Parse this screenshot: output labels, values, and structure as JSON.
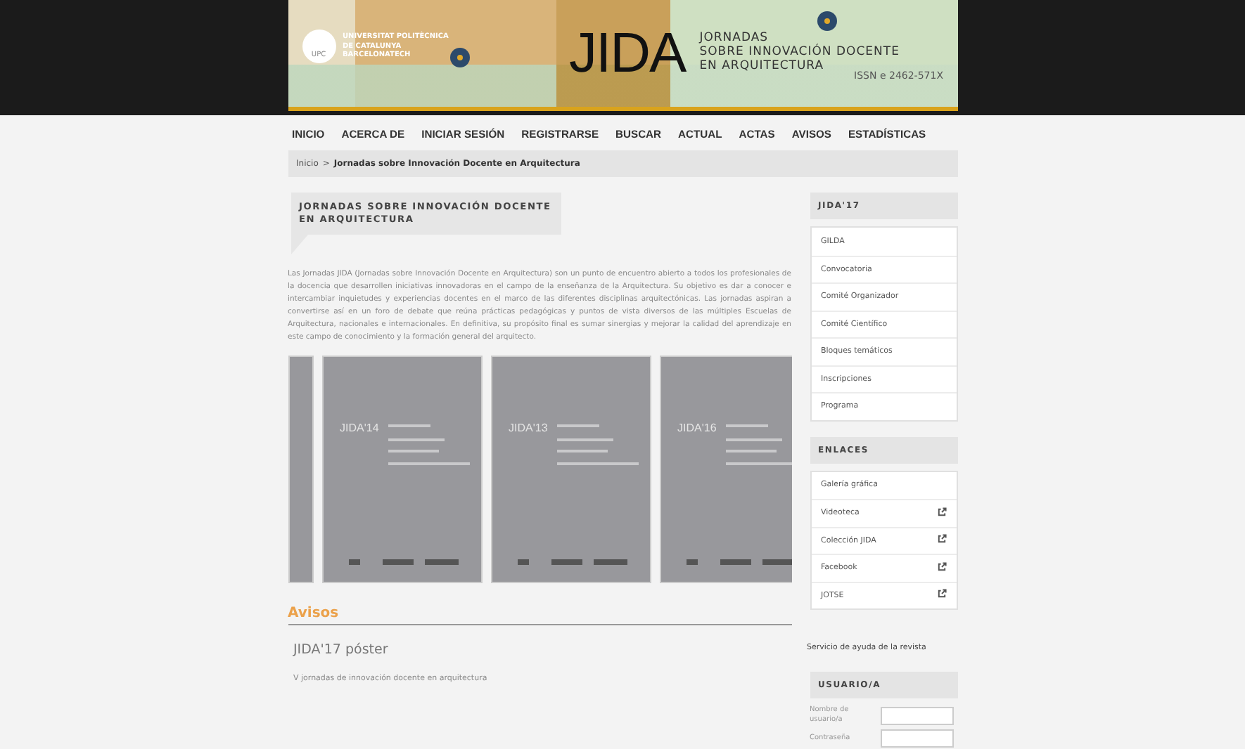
{
  "header": {
    "university": [
      "UNIVERSITAT POLITÈCNICA",
      "DE CATALUNYA",
      "BARCELONATECH"
    ],
    "logo_text": "UPC",
    "brand": "JIDA",
    "subtitle": [
      "JORNADAS",
      "SOBRE INNOVACIÓN DOCENTE",
      "EN ARQUITECTURA"
    ],
    "issn": "ISSN e 2462-571X"
  },
  "nav": [
    "INICIO",
    "ACERCA DE",
    "INICIAR SESIÓN",
    "REGISTRARSE",
    "BUSCAR",
    "ACTUAL",
    "ACTAS",
    "AVISOS",
    "ESTADÍSTICAS"
  ],
  "breadcrumb": {
    "home": "Inicio",
    "separator": ">",
    "current": "Jornadas sobre Innovación Docente en Arquitectura"
  },
  "main": {
    "title": "JORNADAS SOBRE INNOVACIÓN DOCENTE EN ARQUITECTURA",
    "intro": "Las Jornadas JIDA (Jornadas sobre Innovación Docente en Arquitectura) son un punto de encuentro abierto a todos los profesionales de la docencia que desarrollen iniciativas innovadoras en el campo de la enseñanza de la Arquitectura. Su objetivo es dar a conocer e intercambiar inquietudes y experiencias docentes en el marco de las diferentes disciplinas arquitectónicas. Las jornadas aspiran a convertirse así en un foro de debate que reúna prácticas pedagógicas y puntos de vista diversos de las múltiples Escuelas de Arquitectura, nacionales e internacionales. En definitiva, su propósito final es sumar sinergias y mejorar la calidad del aprendizaje en este campo de conocimiento y la formación general del arquitecto.",
    "covers": [
      {
        "kind": "partial"
      },
      {
        "kind": "full",
        "title": "JIDA'14"
      },
      {
        "kind": "full",
        "title": "JIDA'13"
      },
      {
        "kind": "full",
        "title": "JIDA'16"
      }
    ],
    "notices": {
      "heading": "Avisos",
      "items": [
        {
          "title": "JIDA'17 póster",
          "summary": "V jornadas de innovación docente en arquitectura"
        }
      ]
    }
  },
  "sidebar": {
    "blocks": [
      {
        "kind": "links",
        "heading": "JIDA'17",
        "items": [
          {
            "label": "GILDA",
            "external": false
          },
          {
            "label": "Convocatoria",
            "external": false
          },
          {
            "label": "Comité Organizador",
            "external": false
          },
          {
            "label": "Comité Científico",
            "external": false
          },
          {
            "label": "Bloques temáticos",
            "external": false
          },
          {
            "label": "Inscripciones",
            "external": false
          },
          {
            "label": "Programa",
            "external": false
          }
        ]
      },
      {
        "kind": "links",
        "heading": "ENLACES",
        "items": [
          {
            "label": "Galería gráfica",
            "external": false
          },
          {
            "label": "Videoteca",
            "external": true
          },
          {
            "label": "Colección JIDA",
            "external": true
          },
          {
            "label": "Facebook",
            "external": true
          },
          {
            "label": "JOTSE",
            "external": true
          }
        ]
      },
      {
        "kind": "text",
        "text": "Servicio de ayuda de la revista"
      },
      {
        "kind": "login",
        "heading": "USUARIO/A",
        "fields": [
          {
            "label": "Nombre de usuario/a"
          },
          {
            "label": "Contraseña"
          }
        ]
      }
    ]
  }
}
